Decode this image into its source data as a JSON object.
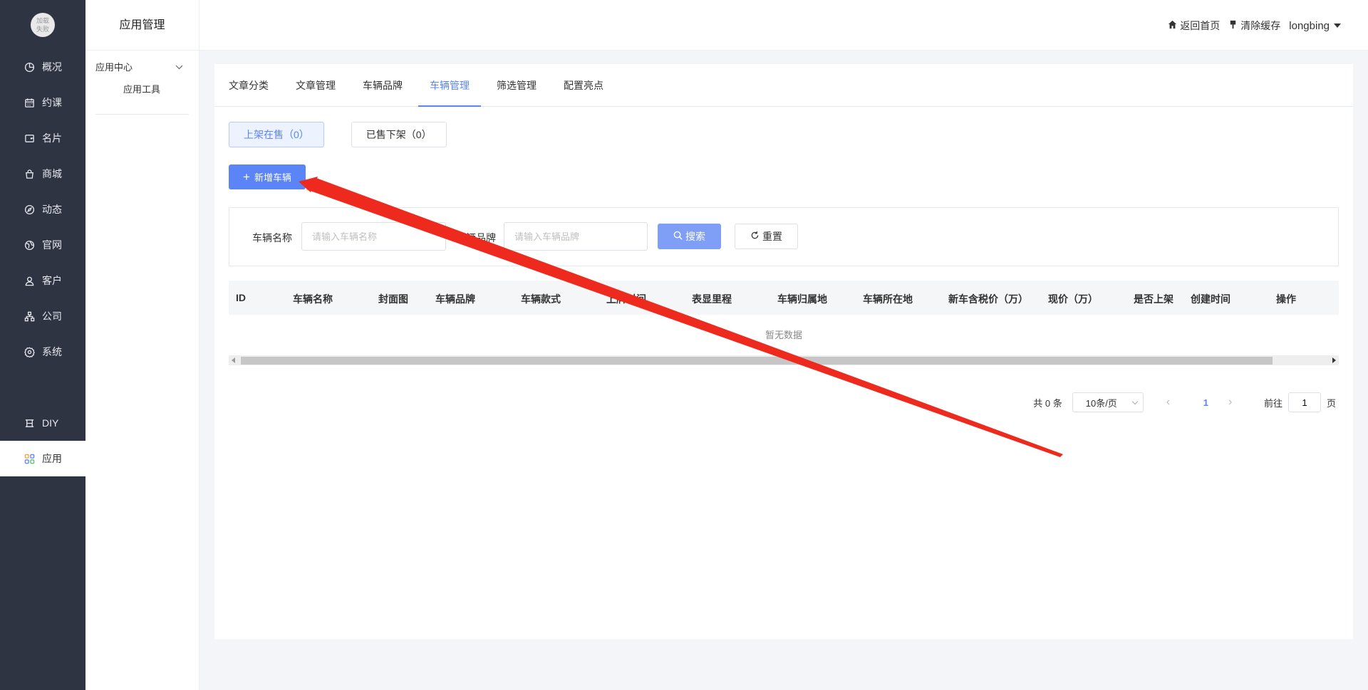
{
  "logo": {
    "line1": "加载",
    "line2": "失败"
  },
  "nav": [
    {
      "label": "概况",
      "icon": "pie-chart-icon"
    },
    {
      "label": "约课",
      "icon": "calendar-icon"
    },
    {
      "label": "名片",
      "icon": "card-icon"
    },
    {
      "label": "商城",
      "icon": "shopping-bag-icon"
    },
    {
      "label": "动态",
      "icon": "compass-icon"
    },
    {
      "label": "官网",
      "icon": "globe-icon"
    },
    {
      "label": "客户",
      "icon": "user-icon"
    },
    {
      "label": "公司",
      "icon": "org-chart-icon"
    },
    {
      "label": "系统",
      "icon": "gear-icon"
    },
    {
      "label": "DIY",
      "icon": "diy-icon"
    },
    {
      "label": "应用",
      "icon": "apps-icon",
      "active": true
    }
  ],
  "subpanel": {
    "title": "应用管理",
    "group": "应用中心",
    "item": "应用工具"
  },
  "header": {
    "home": "返回首页",
    "clear_cache": "清除缓存",
    "user": "longbing"
  },
  "tabs": [
    "文章分类",
    "文章管理",
    "车辆品牌",
    "车辆管理",
    "筛选管理",
    "配置亮点"
  ],
  "active_tab": "车辆管理",
  "status": {
    "on_sale": "上架在售（0）",
    "sold": "已售下架（0）"
  },
  "add_button": "新增车辆",
  "search": {
    "name_label": "车辆名称",
    "name_placeholder": "请输入车辆名称",
    "brand_label": "车辆品牌",
    "brand_placeholder": "请输入车辆品牌",
    "search_label": "搜索",
    "reset_label": "重置"
  },
  "table": {
    "columns": [
      "ID",
      "车辆名称",
      "封面图",
      "车辆品牌",
      "车辆款式",
      "上牌时间",
      "表显里程",
      "车辆归属地",
      "车辆所在地",
      "新车含税价（万）",
      "现价（万）",
      "是否上架",
      "创建时间",
      "操作"
    ],
    "empty": "暂无数据"
  },
  "pagination": {
    "total": "共 0 条",
    "page_size": "10条/页",
    "current": "1",
    "goto_label": "前往",
    "goto_value": "1",
    "page_suffix": "页"
  },
  "colors": {
    "primary": "#5b84f6",
    "sidebar": "#2f3442",
    "annotation_arrow": "#ee2a1f"
  }
}
